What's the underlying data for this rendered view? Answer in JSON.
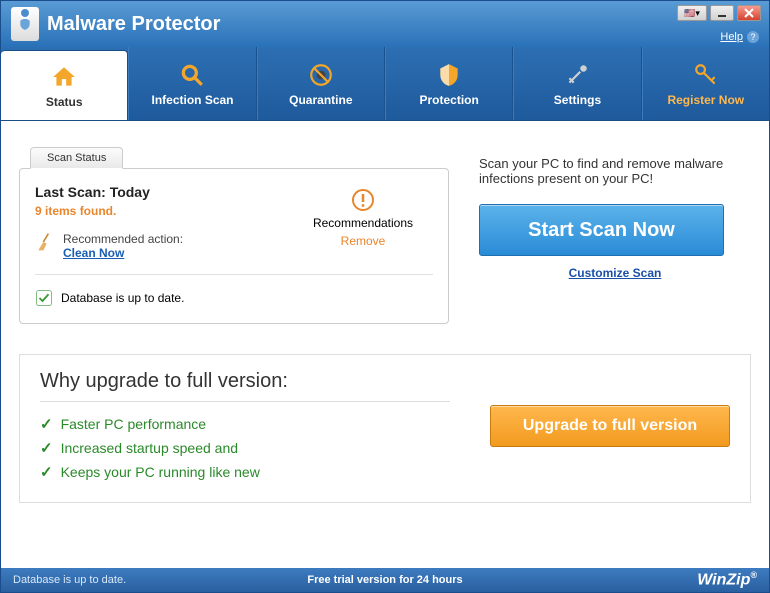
{
  "app_title": "Malware Protector",
  "help_label": "Help",
  "tabs": [
    {
      "label": "Status"
    },
    {
      "label": "Infection Scan"
    },
    {
      "label": "Quarantine"
    },
    {
      "label": "Protection"
    },
    {
      "label": "Settings"
    },
    {
      "label": "Register Now"
    }
  ],
  "scan_card": {
    "tab_label": "Scan Status",
    "last_scan": "Last Scan: Today",
    "items_found": "9 items found.",
    "recommended_action_label": "Recommended action:",
    "clean_now": "Clean Now",
    "recommendations": "Recommendations",
    "remove": "Remove",
    "db_status": "Database is up to date."
  },
  "right": {
    "description": "Scan your PC to find and remove malware infections present on your PC!",
    "scan_btn": "Start Scan Now",
    "customize": "Customize Scan"
  },
  "upgrade": {
    "title": "Why upgrade to full version:",
    "items": [
      "Faster PC performance",
      "Increased startup speed and",
      "Keeps your PC running like new"
    ],
    "btn": "Upgrade to full version"
  },
  "footer": {
    "left": "Database is up to date.",
    "center": "Free trial version for 24 hours",
    "right": "WinZip"
  }
}
